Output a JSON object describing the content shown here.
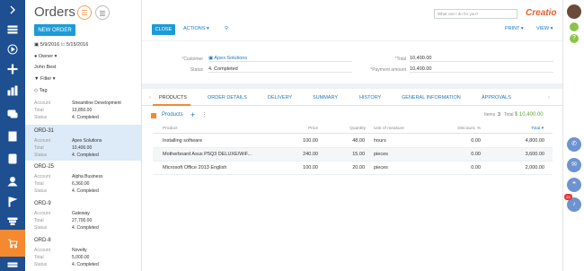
{
  "nav": {
    "items": [
      "chevron-right",
      "menu",
      "play",
      "plus",
      "chart",
      "chat",
      "building",
      "book",
      "person",
      "flag",
      "filter",
      "cart",
      "lines"
    ]
  },
  "list": {
    "title": "Orders",
    "new_button": "NEW ORDER",
    "date_from": "5/9/2016",
    "date_to": "5/15/2016",
    "date_sep": "to",
    "owner_label": "Owner",
    "owner_value": "John Best",
    "filter_label": "Filter",
    "tag_label": "Tag",
    "labels": {
      "account": "Account",
      "total": "Total",
      "status": "Status"
    },
    "first_item": {
      "account": "Streamline Development",
      "total": "13,850.00",
      "status": "4. Completed"
    },
    "items": [
      {
        "title": "ORD-31",
        "account": "Apex Solutions",
        "total": "10,400.00",
        "status": "4. Completed"
      },
      {
        "title": "ORD-25",
        "account": "Alpha Business",
        "total": "6,360.00",
        "status": "4. Completed"
      },
      {
        "title": "ORD-9",
        "account": "Gateway",
        "total": "27,700.00",
        "status": "4. Completed"
      },
      {
        "title": "ORD-8",
        "account": "Novelty",
        "total": "5,000.00",
        "status": "4. Completed"
      }
    ]
  },
  "toolbar": {
    "close": "CLOSE",
    "actions": "ACTIONS",
    "print": "PRINT",
    "view": "VIEW",
    "search_placeholder": "What can I do for you?",
    "logo": "Creatio"
  },
  "record": {
    "customer_label": "Customer",
    "customer_value": "Apex Solutions",
    "status_label": "Status",
    "status_value": "4. Completed",
    "total_label": "Total",
    "total_value": "10,400.00",
    "payment_label": "Payment amount",
    "payment_value": "10,400.00"
  },
  "tabs": [
    "PRODUCTS",
    "ORDER DETAILS",
    "DELIVERY",
    "SUMMARY",
    "HISTORY",
    "GENERAL INFORMATION",
    "APPROVALS"
  ],
  "products": {
    "title": "Products",
    "items_label": "Items",
    "items_count": "3",
    "total_label": "Total",
    "total_value": "$ 10,400.00",
    "columns": [
      "Product",
      "Price",
      "Quantity",
      "Unit of measure",
      "Discount, %",
      "Total"
    ],
    "rows": [
      [
        "Installing software",
        "100.00",
        "48.00",
        "hours",
        "0.00",
        "4,800.00"
      ],
      [
        "Motherboard Asus P5Q3 DELUXE/WiF...",
        "240.00",
        "15.00",
        "pieces",
        "0.00",
        "3,600.00"
      ],
      [
        "Microsoft Office 2013 English",
        "100.00",
        "20.00",
        "pieces",
        "0.00",
        "2,000.00"
      ]
    ]
  },
  "rightbar": {
    "badge": "24"
  },
  "colors": {
    "nav": "#1d4f91",
    "accent": "#f4892f",
    "primary": "#1d9bd6",
    "link": "#1d78c1"
  }
}
